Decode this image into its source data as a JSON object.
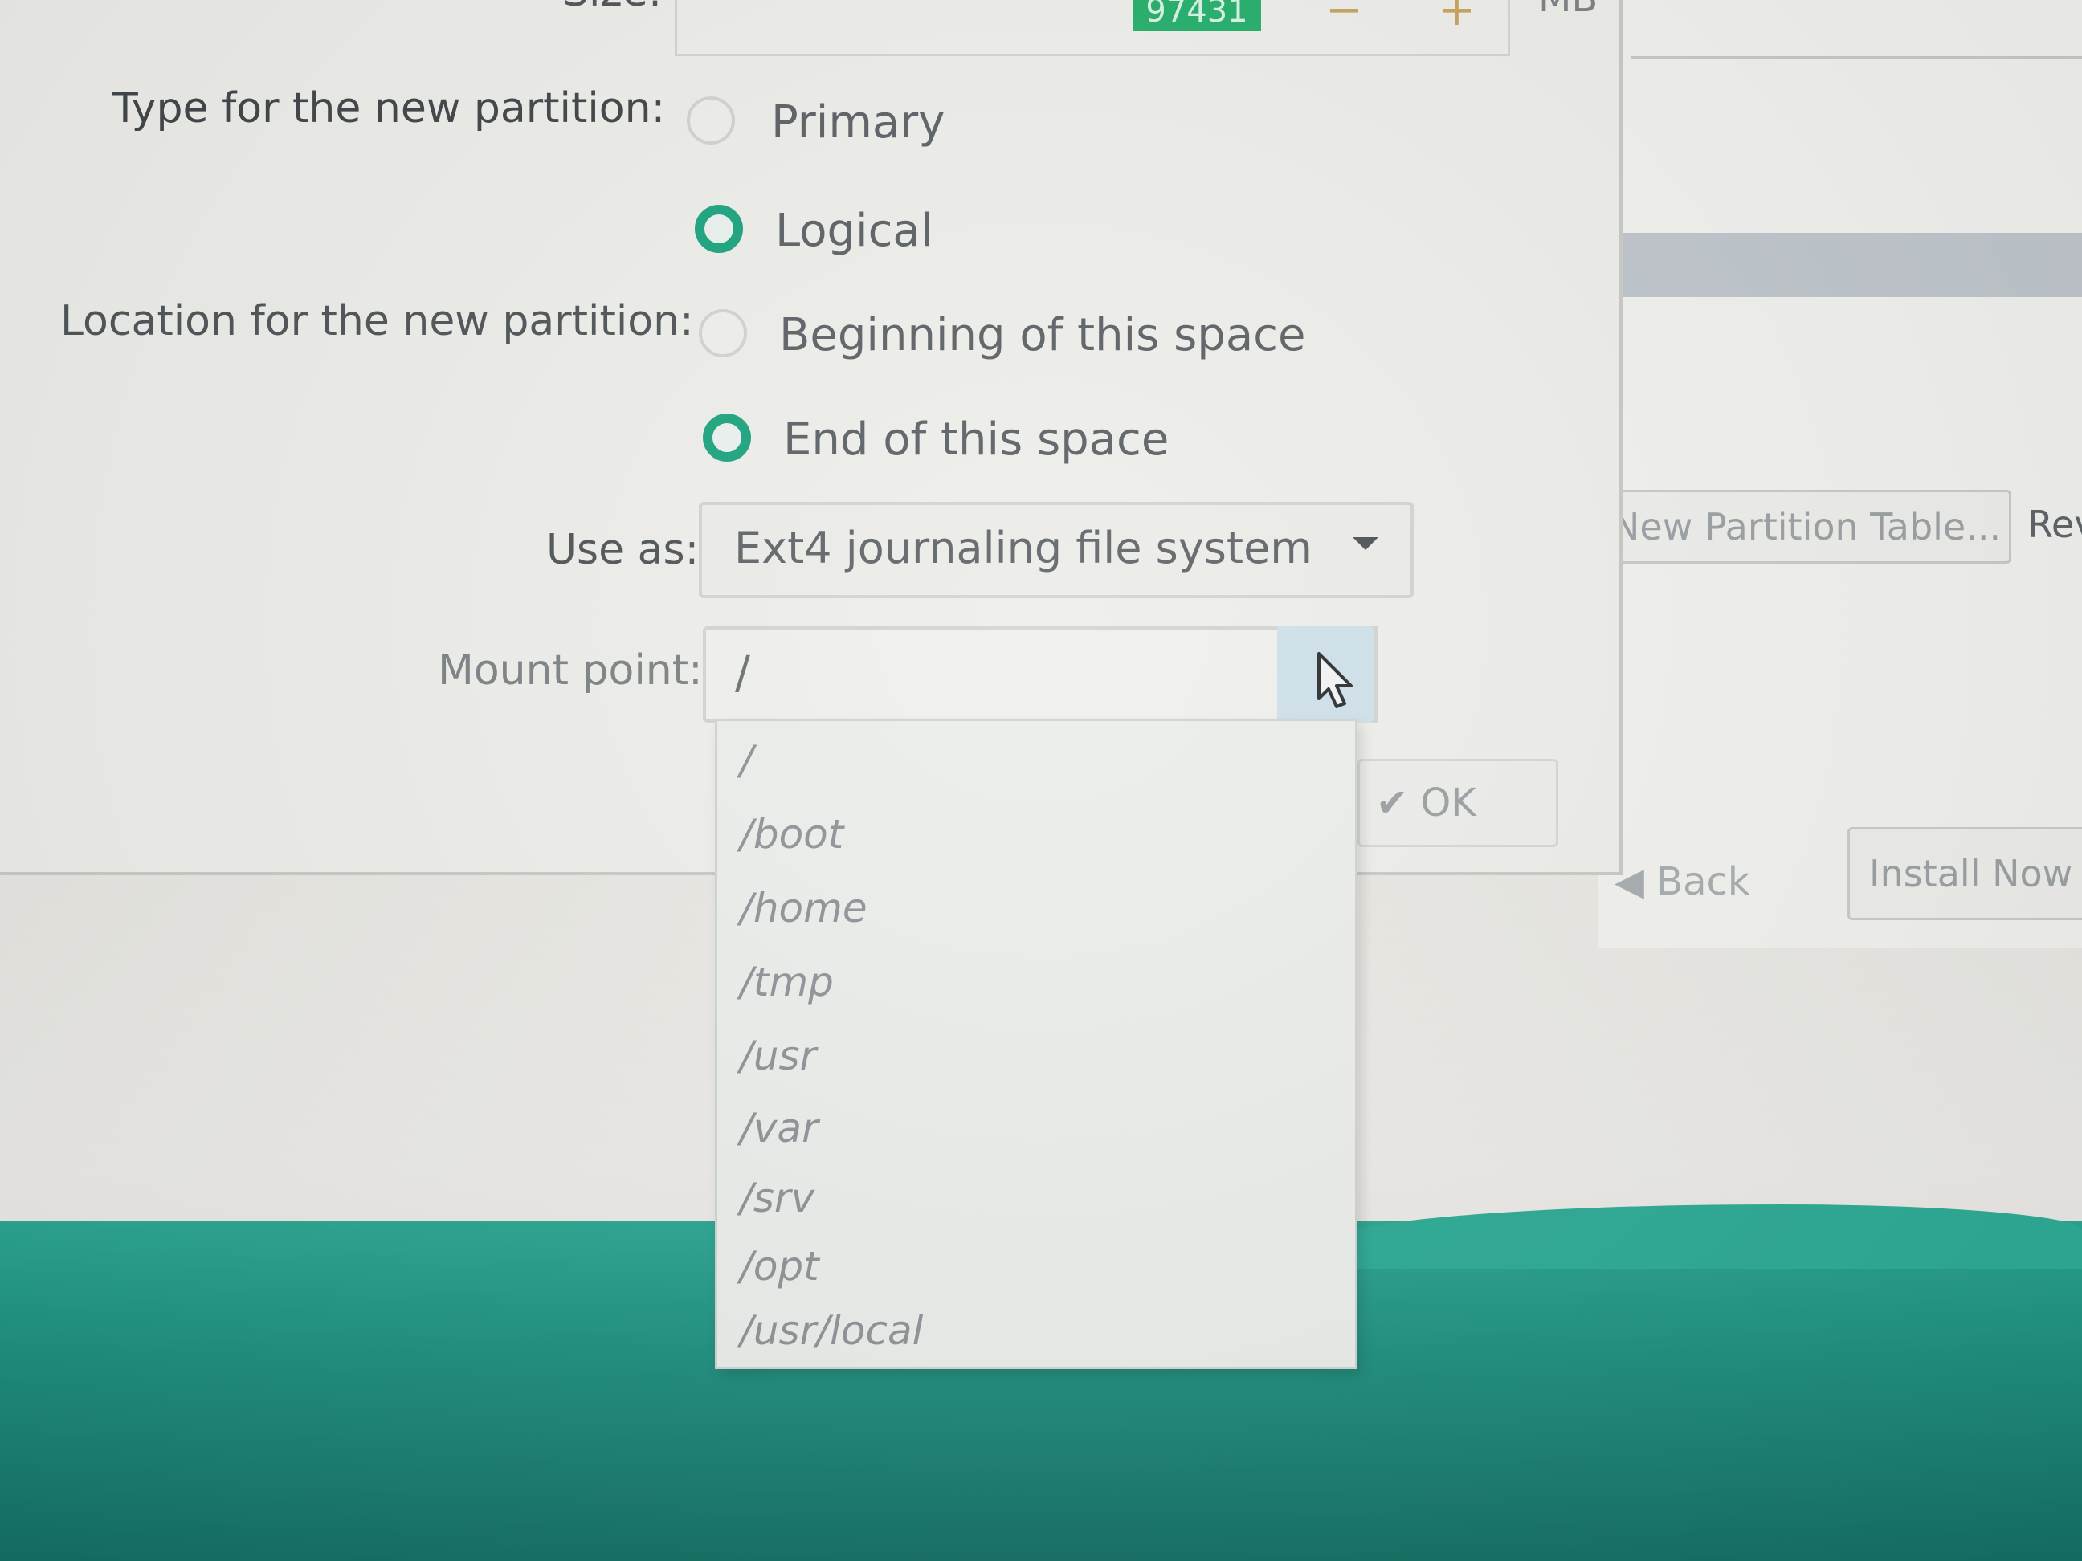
{
  "dialog": {
    "size": {
      "label": "Size:",
      "value": "97431",
      "unit": "MB",
      "minus": "−",
      "plus": "+"
    },
    "partition_type": {
      "label": "Type for the new partition:",
      "options": [
        {
          "label": "Primary",
          "checked": false
        },
        {
          "label": "Logical",
          "checked": true
        }
      ]
    },
    "location": {
      "label": "Location for the new partition:",
      "options": [
        {
          "label": "Beginning of this space",
          "checked": false
        },
        {
          "label": "End of this space",
          "checked": true
        }
      ]
    },
    "use_as": {
      "label": "Use as:",
      "value": "Ext4 journaling file system"
    },
    "mount_point": {
      "label": "Mount point:",
      "value": "/",
      "options": [
        "/",
        "/boot",
        "/home",
        "/tmp",
        "/usr",
        "/var",
        "/srv",
        "/opt",
        "/usr/local"
      ]
    },
    "ok_label": "OK"
  },
  "background_window": {
    "partition_table_button": "New Partition Table...",
    "revert_button": "Revert",
    "back_button": "Back",
    "install_button": "Install Now"
  },
  "colors": {
    "radio_checked": "#1aa37e",
    "wallpaper": "#1e8f7e",
    "size_highlight": "#23b06a"
  }
}
